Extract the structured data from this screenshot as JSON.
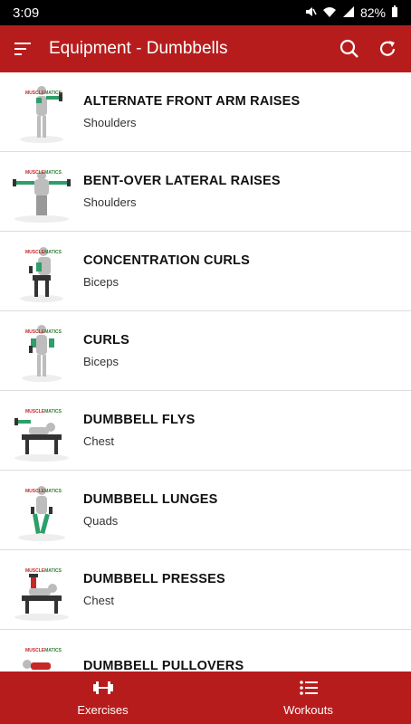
{
  "status": {
    "time": "3:09",
    "battery": "82%"
  },
  "appbar": {
    "title": "Equipment - Dumbbells"
  },
  "exercises": [
    {
      "name": "ALTERNATE FRONT ARM RAISES",
      "muscle": "Shoulders"
    },
    {
      "name": "BENT-OVER LATERAL RAISES",
      "muscle": "Shoulders"
    },
    {
      "name": "CONCENTRATION CURLS",
      "muscle": "Biceps"
    },
    {
      "name": "CURLS",
      "muscle": "Biceps"
    },
    {
      "name": "DUMBBELL FLYS",
      "muscle": "Chest"
    },
    {
      "name": "DUMBBELL LUNGES",
      "muscle": "Quads"
    },
    {
      "name": "DUMBBELL PRESSES",
      "muscle": "Chest"
    },
    {
      "name": "DUMBBELL PULLOVERS",
      "muscle": ""
    }
  ],
  "nav": {
    "exercises": "Exercises",
    "workouts": "Workouts"
  },
  "colors": {
    "primary": "#b71c1c"
  }
}
